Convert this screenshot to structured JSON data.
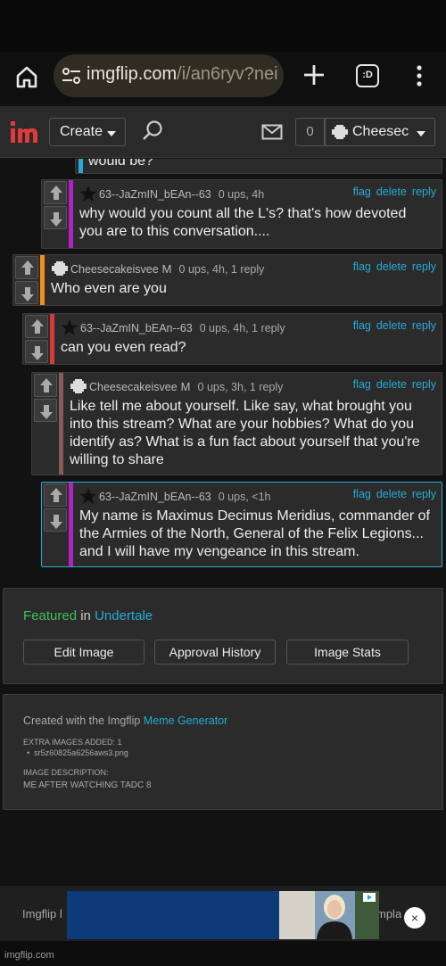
{
  "browser": {
    "url_host": "imgflip.com",
    "url_path": "/i/an6ryv?nei",
    "tabs_label": ":D"
  },
  "nav": {
    "create_label": "Create",
    "notif_count": "0",
    "username": "Cheesecakeisvee"
  },
  "comments": [
    {
      "user": "63--JaZmIN_bEAn--63",
      "meta": "0 ups, 4h",
      "badge": "",
      "body": "why would you count all the L's? that's how devoted you are to this conversation....",
      "stripe": "#b41fc8"
    },
    {
      "user": "Cheesecakeisvee",
      "meta": "0 ups, 4h, 1 reply",
      "badge": "M",
      "body": "Who even are you",
      "stripe": "#f28c1c"
    },
    {
      "user": "63--JaZmIN_bEAn--63",
      "meta": "0 ups, 4h, 1 reply",
      "badge": "",
      "body": "can you even read?",
      "stripe": "#d83a3a"
    },
    {
      "user": "Cheesecakeisvee",
      "meta": "0 ups, 3h, 1 reply",
      "badge": "M",
      "body": "Like tell me about yourself. Like say, what brought you into this stream? What are your hobbies? What do you identify as? What is a fun fact about yourself that you're willing to share",
      "stripe": "#8a5a5a"
    },
    {
      "user": "63--JaZmIN_bEAn--63",
      "meta": "0 ups, <1h",
      "badge": "",
      "body": "My name is Maximus Decimus Meridius, commander of the Armies of the North, General of the Felix Legions... and I will have my vengeance in this stream.",
      "stripe": "#b41fc8"
    }
  ],
  "partial_comment_text": "would be?",
  "comment_links": {
    "flag": "flag",
    "delete": "delete",
    "reply": "reply"
  },
  "featured": {
    "featured_word": "Featured",
    "in_word": "in",
    "stream": "Undertale",
    "buttons": [
      "Edit Image",
      "Approval History",
      "Image Stats"
    ]
  },
  "info": {
    "created_prefix": "Created with the Imgflip",
    "created_link": "Meme Generator",
    "extra_images_label": "EXTRA IMAGES ADDED: 1",
    "extra_image_file": "sr5z60825a6256aws3.png",
    "description_label": "IMAGE DESCRIPTION:",
    "description": "ME AFTER WATCHING TADC 8"
  },
  "footer": {
    "left_label": "Imgflip l",
    "right_label": "mpla",
    "url": "imgflip.com",
    "ad_close": "×"
  },
  "colors": {
    "link": "#28a9d6",
    "featured_green": "#3fbf5f",
    "partial_stripe": "#28a9d6"
  }
}
